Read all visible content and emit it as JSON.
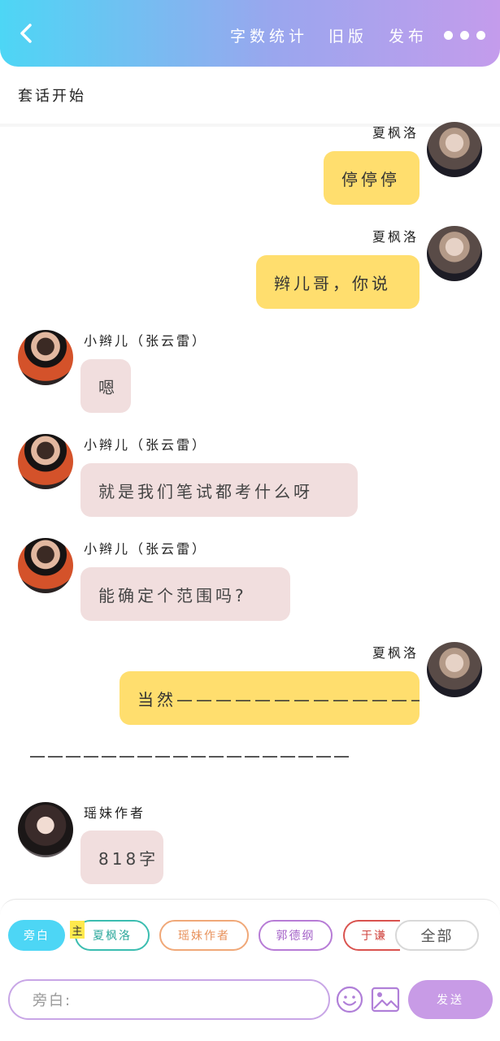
{
  "header": {
    "back_icon": "chevron-left-icon",
    "word_count_label": "字数统计",
    "old_version_label": "旧版",
    "publish_label": "发布",
    "more_icon": "more-dots-icon"
  },
  "subtitle": "套话开始",
  "messages": [
    {
      "sender": "夏枫洛",
      "text": "停停停"
    },
    {
      "sender": "夏枫洛",
      "text": "辫儿哥，你说"
    },
    {
      "sender": "小辫儿（张云雷）",
      "text": "嗯"
    },
    {
      "sender": "小辫儿（张云雷）",
      "text": "就是我们笔试都考什么呀"
    },
    {
      "sender": "小辫儿（张云雷）",
      "text": "能确定个范围吗?"
    },
    {
      "sender": "夏枫洛",
      "text": "当然——————————————"
    },
    {
      "narration": "——————————————————"
    },
    {
      "sender": "瑶妹作者",
      "text": "818字"
    }
  ],
  "roles": {
    "narrator": "旁白",
    "main_badge": "主",
    "xiafengluo": "夏枫洛",
    "author": "瑶妹作者",
    "guodegang": "郭德纲",
    "yuqian": "于谦",
    "all": "全部"
  },
  "input": {
    "placeholder": "旁白:"
  },
  "send_label": "发送",
  "colors": {
    "header_start": "#4dd6f5",
    "header_end": "#c49cec",
    "bubble_self": "#ffde6e",
    "bubble_other": "#f1dede",
    "narrator_chip": "#4dd6f5",
    "send_button": "#c89be6"
  }
}
